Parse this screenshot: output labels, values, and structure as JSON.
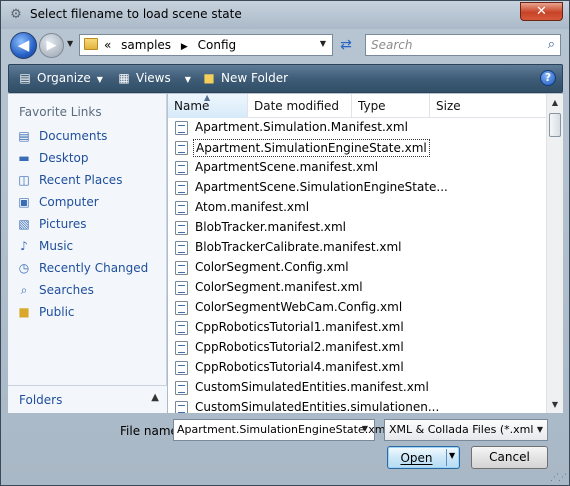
{
  "window": {
    "title": "Select filename to load scene state",
    "close_glyph": "✕"
  },
  "nav": {
    "back_glyph": "◀",
    "forward_glyph": "▶",
    "breadcrumb": [
      "«",
      "samples",
      "Config"
    ],
    "refresh_glyph": "⇄",
    "search_placeholder": "Search"
  },
  "toolbar": {
    "organize": "Organize",
    "views": "Views",
    "new_folder": "New Folder",
    "help": "?"
  },
  "sidebar": {
    "header": "Favorite Links",
    "items": [
      {
        "label": "Documents",
        "icon": "documents-icon"
      },
      {
        "label": "Desktop",
        "icon": "desktop-icon"
      },
      {
        "label": "Recent Places",
        "icon": "recent-places-icon"
      },
      {
        "label": "Computer",
        "icon": "computer-icon"
      },
      {
        "label": "Pictures",
        "icon": "pictures-icon"
      },
      {
        "label": "Music",
        "icon": "music-icon"
      },
      {
        "label": "Recently Changed",
        "icon": "recently-changed-icon"
      },
      {
        "label": "Searches",
        "icon": "searches-icon"
      },
      {
        "label": "Public",
        "icon": "public-folder-icon"
      }
    ],
    "folders_label": "Folders"
  },
  "columns": [
    "Name",
    "Date modified",
    "Type",
    "Size"
  ],
  "files": [
    "Apartment.Simulation.Manifest.xml",
    "Apartment.SimulationEngineState.xml",
    "ApartmentScene.manifest.xml",
    "ApartmentScene.SimulationEngineState...",
    "Atom.manifest.xml",
    "BlobTracker.manifest.xml",
    "BlobTrackerCalibrate.manifest.xml",
    "ColorSegment.Config.xml",
    "ColorSegment.manifest.xml",
    "ColorSegmentWebCam.Config.xml",
    "CppRoboticsTutorial1.manifest.xml",
    "CppRoboticsTutorial2.manifest.xml",
    "CppRoboticsTutorial4.manifest.xml",
    "CustomSimulatedEntities.manifest.xml",
    "CustomSimulatedEntities.simulationen..."
  ],
  "selected_file_index": 1,
  "bottom": {
    "file_name_label": "File name:",
    "file_name_value": "Apartment.SimulationEngineState.xml",
    "file_type_value": "XML & Collada Files (*.xml;*.dae)",
    "open_label": "Open",
    "cancel_label": "Cancel"
  }
}
